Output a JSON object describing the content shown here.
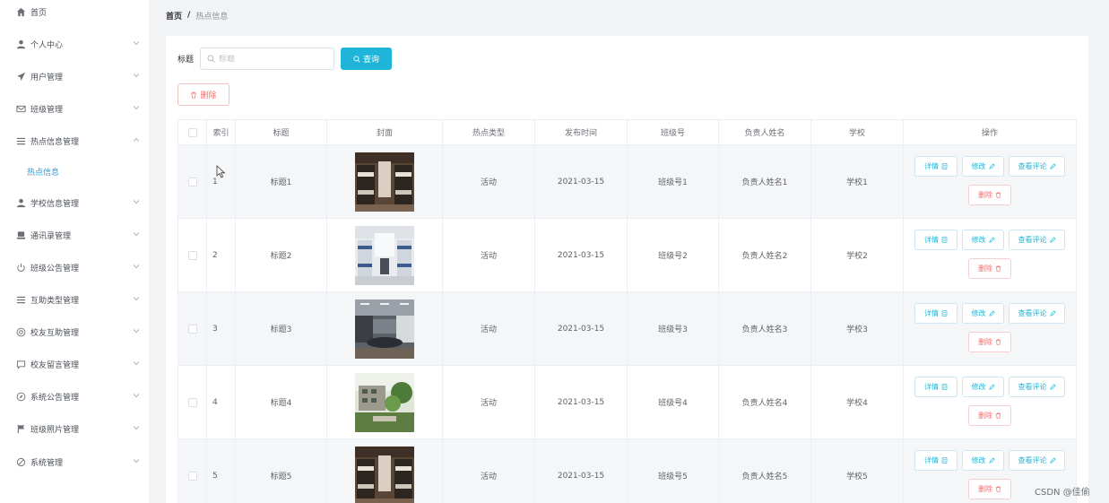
{
  "sidebar": {
    "items": [
      {
        "label": "首页",
        "icon": "home-icon",
        "has_chevron": false
      },
      {
        "label": "个人中心",
        "icon": "user-icon",
        "has_chevron": true
      },
      {
        "label": "用户管理",
        "icon": "send-icon",
        "has_chevron": true
      },
      {
        "label": "班级管理",
        "icon": "mail-icon",
        "has_chevron": true
      },
      {
        "label": "热点信息管理",
        "icon": "menu-icon",
        "has_chevron": true,
        "expanded": true,
        "children": [
          {
            "label": "热点信息",
            "active": true
          }
        ]
      },
      {
        "label": "学校信息管理",
        "icon": "school-user-icon",
        "has_chevron": true
      },
      {
        "label": "通讯录管理",
        "icon": "contacts-icon",
        "has_chevron": true
      },
      {
        "label": "班级公告管理",
        "icon": "power-icon",
        "has_chevron": true
      },
      {
        "label": "互助类型管理",
        "icon": "list-icon",
        "has_chevron": true
      },
      {
        "label": "校友互助管理",
        "icon": "help-icon",
        "has_chevron": true
      },
      {
        "label": "校友留言管理",
        "icon": "message-icon",
        "has_chevron": true
      },
      {
        "label": "系统公告管理",
        "icon": "compass-icon",
        "has_chevron": true
      },
      {
        "label": "班级照片管理",
        "icon": "flag-icon",
        "has_chevron": true
      },
      {
        "label": "系统管理",
        "icon": "settings-icon",
        "has_chevron": true
      }
    ]
  },
  "breadcrumb": {
    "home": "首页",
    "separator": "/",
    "current": "热点信息"
  },
  "search": {
    "label": "标题",
    "placeholder": "标题",
    "value": "",
    "button": "查询"
  },
  "toolbar": {
    "delete_label": "删除"
  },
  "table": {
    "headers": [
      "索引",
      "标题",
      "封面",
      "热点类型",
      "发布时间",
      "班级号",
      "负责人姓名",
      "学校",
      "操作"
    ],
    "rows": [
      {
        "index": "1",
        "title": "标题1",
        "type": "活动",
        "date": "2021-03-15",
        "class": "班级号1",
        "owner": "负责人姓名1",
        "school": "学校1",
        "cover": "dorm-bunk-room"
      },
      {
        "index": "2",
        "title": "标题2",
        "type": "活动",
        "date": "2021-03-15",
        "class": "班级号2",
        "owner": "负责人姓名2",
        "school": "学校2",
        "cover": "dorm-bright-room"
      },
      {
        "index": "3",
        "title": "标题3",
        "type": "活动",
        "date": "2021-03-15",
        "class": "班级号3",
        "owner": "负责人姓名3",
        "school": "学校3",
        "cover": "meeting-room"
      },
      {
        "index": "4",
        "title": "标题4",
        "type": "活动",
        "date": "2021-03-15",
        "class": "班级号4",
        "owner": "负责人姓名4",
        "school": "学校4",
        "cover": "campus-building"
      },
      {
        "index": "5",
        "title": "标题5",
        "type": "活动",
        "date": "2021-03-15",
        "class": "班级号5",
        "owner": "负责人姓名5",
        "school": "学校5",
        "cover": "dorm-bunk-room"
      }
    ],
    "actions": {
      "detail": "详情",
      "edit": "修改",
      "view_comments": "查看评论",
      "delete": "删除"
    }
  },
  "watermark": "CSDN @佳偷",
  "colors": {
    "accent": "#1fb5d8",
    "danger": "#f56c6c",
    "active_menu": "#2f9bd6",
    "main_bg": "#f2f3f5"
  }
}
